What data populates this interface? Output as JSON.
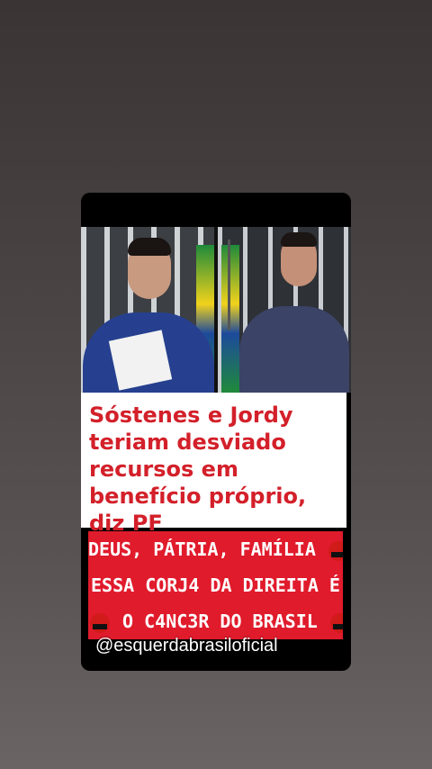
{
  "post": {
    "headline": "Sóstenes e Jordy teriam desviado recursos em benefício próprio, diz PF",
    "banner_line1": "DEUS, PÁTRIA, FAMÍLIA",
    "banner_line2": "ESSA CORJ4 DA DIREITA É",
    "banner_line3": "O C4NC3R DO BRASIL",
    "handle": "@esquerdabrasiloficial",
    "emoji": "angry-cursing-face-icon"
  },
  "colors": {
    "headline": "#d3202a",
    "banner": "#e01b2c",
    "background": "#4a4444"
  }
}
